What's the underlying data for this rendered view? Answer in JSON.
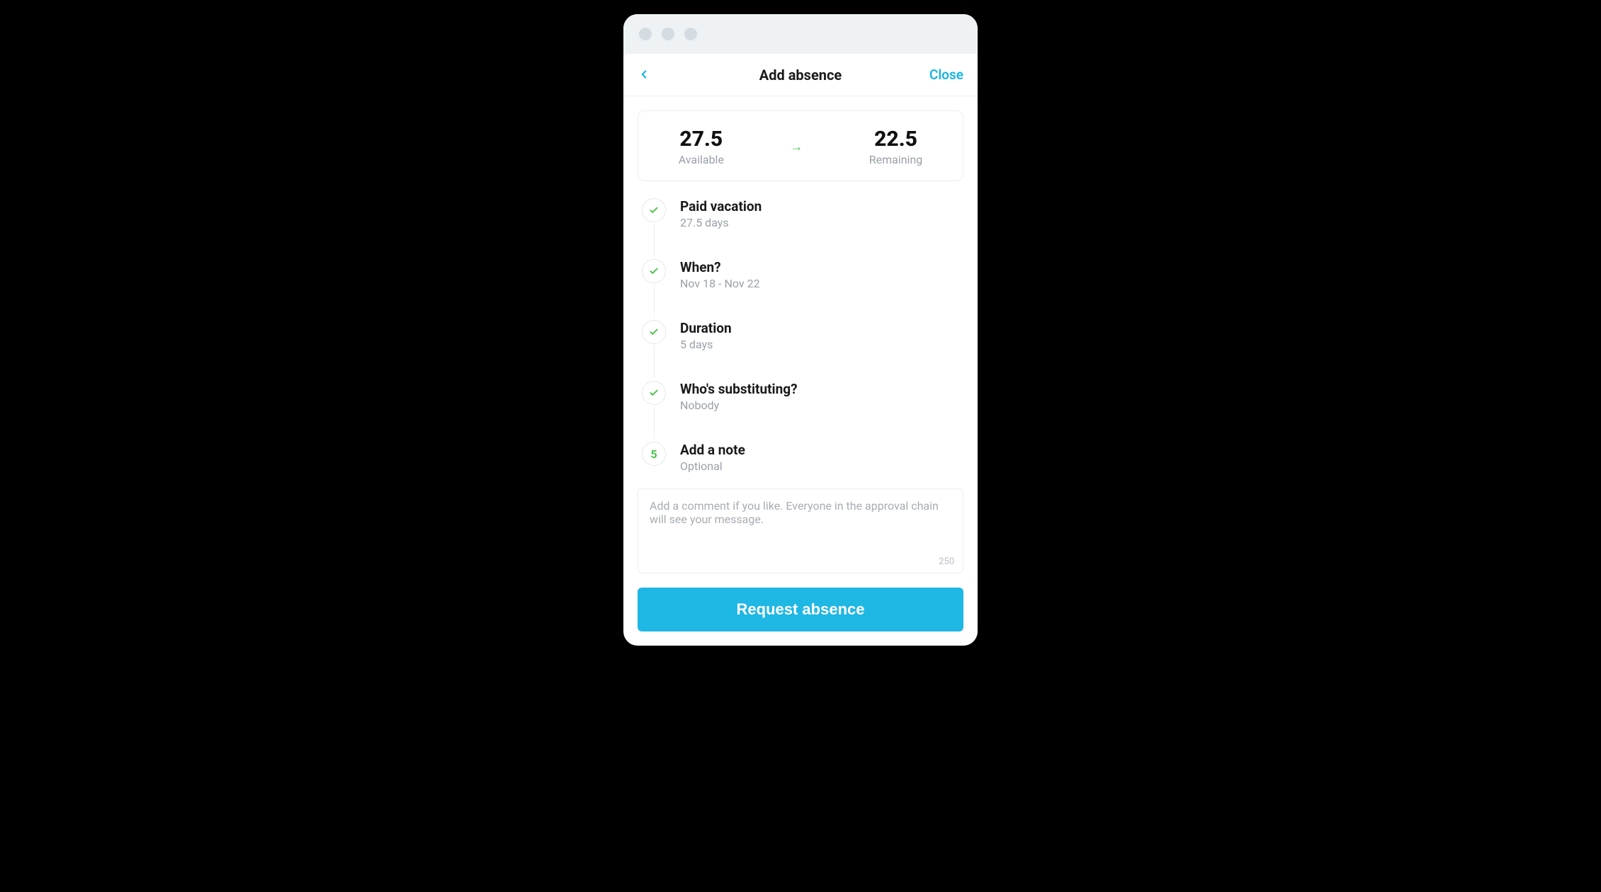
{
  "header": {
    "title": "Add absence",
    "close_label": "Close"
  },
  "balance": {
    "available_value": "27.5",
    "available_label": "Available",
    "remaining_value": "22.5",
    "remaining_label": "Remaining"
  },
  "steps": [
    {
      "title": "Paid vacation",
      "subtitle": "27.5 days",
      "badge": "check"
    },
    {
      "title": "When?",
      "subtitle": "Nov 18 - Nov 22",
      "badge": "check"
    },
    {
      "title": "Duration",
      "subtitle": "5 days",
      "badge": "check"
    },
    {
      "title": "Who's substituting?",
      "subtitle": "Nobody",
      "badge": "check"
    },
    {
      "title": "Add a note",
      "subtitle": "Optional",
      "badge": "5"
    }
  ],
  "note": {
    "placeholder": "Add a comment if you like. Everyone in the approval chain will see your message.",
    "char_limit": "250"
  },
  "cta_label": "Request absence",
  "colors": {
    "accent": "#1fb7e4",
    "success": "#3fbe3f"
  }
}
